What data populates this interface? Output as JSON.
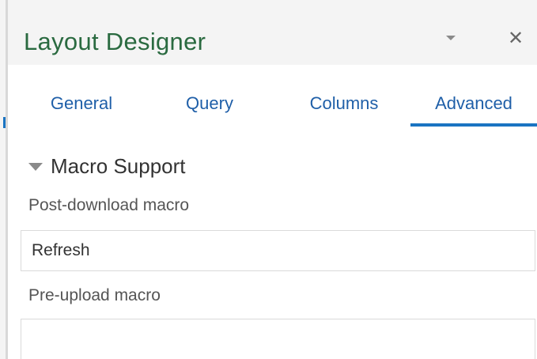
{
  "window": {
    "title": "Layout Designer",
    "dropdown_icon": "chevron-down-icon",
    "close_icon": "close-icon",
    "close_glyph": "✕"
  },
  "tabs": [
    {
      "label": "General",
      "active": false
    },
    {
      "label": "Query",
      "active": false
    },
    {
      "label": "Columns",
      "active": false
    },
    {
      "label": "Advanced",
      "active": true
    }
  ],
  "section": {
    "title": "Macro Support",
    "expanded": true,
    "icon": "triangle-down-icon"
  },
  "fields": {
    "post_download": {
      "label": "Post-download macro",
      "value": "Refresh"
    },
    "pre_upload": {
      "label": "Pre-upload macro",
      "value": ""
    }
  },
  "colors": {
    "accent": "#1a74c2",
    "title": "#2a6a40",
    "tab_text": "#1f5fa8",
    "header_bg": "#f4f4f4"
  }
}
